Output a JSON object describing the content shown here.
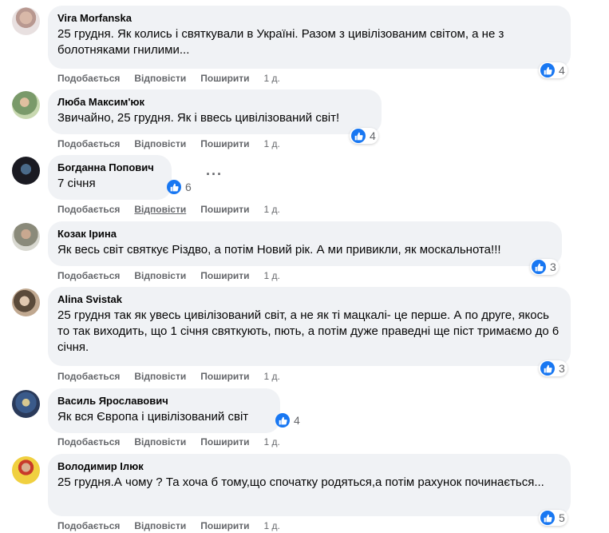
{
  "comments": [
    {
      "author": "Vira Morfanska",
      "text": "25 грудня. Як колись і святкували в Україні. Разом з цивілізованим світом, а не з болотняками гнилими...",
      "likes": "4",
      "like": "Подобається",
      "reply": "Відповісти",
      "share": "Поширити",
      "time": "1 д."
    },
    {
      "author": "Люба Максим'юк",
      "text": "Звичайно, 25 грудня. Як і ввесь цивілізований світ!",
      "likes": "4",
      "like": "Подобається",
      "reply": "Відповісти",
      "share": "Поширити",
      "time": "1 д."
    },
    {
      "author": "Богданна Попович",
      "text": "7 січня",
      "likes": "6",
      "like": "Подобається",
      "reply": "Відповісти",
      "share": "Поширити",
      "time": "1 д.",
      "more": "···"
    },
    {
      "author": "Козак Ірина",
      "text": "Як весь світ святкує Різдво, а потім Новий рік. А ми привикли, як москальнота!!!",
      "likes": "3",
      "like": "Подобається",
      "reply": "Відповісти",
      "share": "Поширити",
      "time": "1 д."
    },
    {
      "author": "Alina Svistak",
      "text": "25 грудня так як увесь цивілізований світ, а не як ті мацкалі- це перше. А по друге, якось то так виходить, що 1 січня святкують, пють, а потім дуже праведні ще піст тримаємо до 6 січня.",
      "likes": "3",
      "like": "Подобається",
      "reply": "Відповісти",
      "share": "Поширити",
      "time": "1 д."
    },
    {
      "author": "Василь Ярославович",
      "text": "Як вся Європа і цивілізований світ",
      "likes": "4",
      "like": "Подобається",
      "reply": "Відповісти",
      "share": "Поширити",
      "time": "1 д."
    },
    {
      "author": "Володимир Ілюк",
      "text": "25 грудня.А чому ? Та хоча б тому,що спочатку родяться,а потім рахунок починається...",
      "likes": "5",
      "like": "Подобається",
      "reply": "Відповісти",
      "share": "Поширити",
      "time": "1 д."
    }
  ],
  "colors": {
    "bubble": "#f0f2f5",
    "like_blue": "#1877f2",
    "meta_gray": "#65676b"
  }
}
